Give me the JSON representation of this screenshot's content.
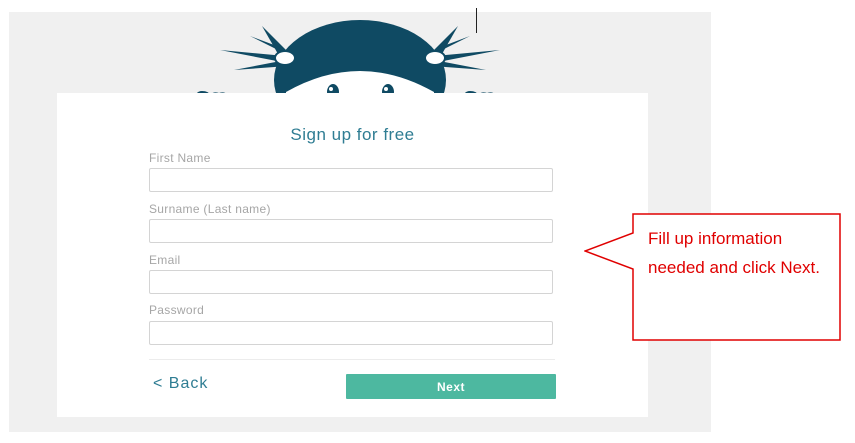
{
  "form": {
    "title": "Sign up for free",
    "fields": [
      {
        "label": "First Name",
        "value": ""
      },
      {
        "label": "Surname (Last name)",
        "value": ""
      },
      {
        "label": "Email",
        "value": ""
      },
      {
        "label": "Password",
        "value": ""
      }
    ],
    "back_label": "< Back",
    "next_label": "Next"
  },
  "callout": {
    "text": "Fill up information needed and click Next."
  },
  "colors": {
    "accent": "#2f7d93",
    "button": "#4db8a0",
    "callout": "#e00000",
    "mascot_hair": "#0f4a63"
  },
  "icons": [
    "mascot-illustration",
    "left-hand-icon",
    "right-hand-icon"
  ]
}
